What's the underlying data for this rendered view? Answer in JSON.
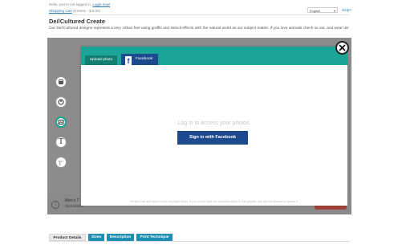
{
  "header": {
    "greeting": "Hello, you're not logged in.",
    "login_link": "Login now!",
    "cart_label": "Shopping Cart",
    "cart_summary": "(0 items - $ 0.00)",
    "language": "English",
    "help": "Help?"
  },
  "page": {
    "title": "De//Cultured Create",
    "description": "Our De//Cultured designs represent a very Urban feel using graffiti and stencil effects with the natural world as our subject matter. If you love animals check us out, and wear us!"
  },
  "designer": {
    "tools": [
      {
        "icon": "product-icon"
      },
      {
        "icon": "design-icon"
      },
      {
        "icon": "image-upload-icon",
        "active": true
      },
      {
        "icon": "text-icon"
      },
      {
        "icon": "text-plus-icon"
      }
    ],
    "product_name": "Men's T",
    "product_brand": "Spreadshirt"
  },
  "modal": {
    "tabs": {
      "upload": "Upload photo",
      "facebook": "Facebook"
    },
    "message": "Log in to access your photos.",
    "signin_button": "Sign in with Facebook",
    "copyright_note": "Please read and agree to the copyright terms. If you do not have the complete rights to this graphic, you are not allowed to upload it."
  },
  "product_tabs": {
    "details": "Product Details",
    "sizes": "Sizes",
    "description": "Description",
    "print_technique": "Print Technique"
  },
  "colors": {
    "accent_teal": "#1aa597",
    "facebook_blue": "#1d4a8f",
    "tab_blue": "#1e8fb3"
  }
}
